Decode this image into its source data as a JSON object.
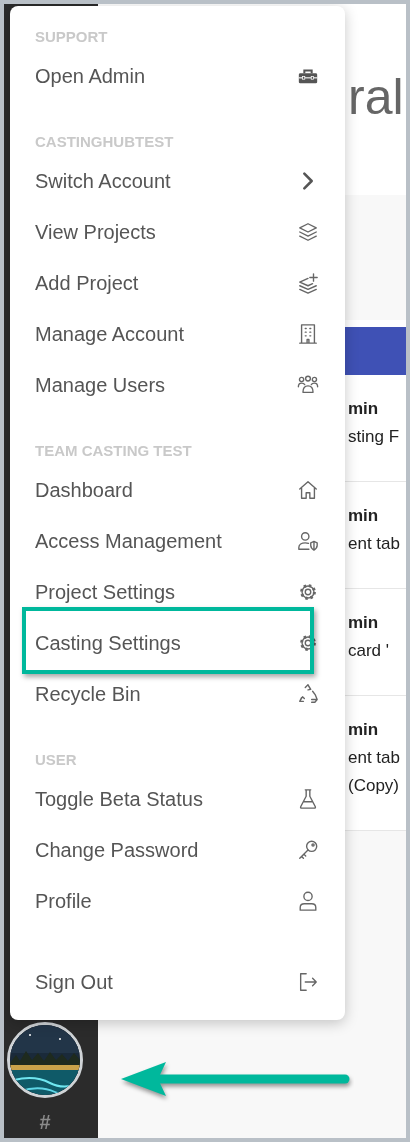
{
  "menu": {
    "sections": [
      {
        "title": "SUPPORT",
        "items": [
          {
            "label": "Open Admin",
            "highlighted": false
          }
        ]
      },
      {
        "title": "CASTINGHUBTEST",
        "items": [
          {
            "label": "Switch Account",
            "highlighted": false
          },
          {
            "label": "View Projects",
            "highlighted": false
          },
          {
            "label": "Add Project",
            "highlighted": false
          },
          {
            "label": "Manage Account",
            "highlighted": false
          },
          {
            "label": "Manage Users",
            "highlighted": false
          }
        ]
      },
      {
        "title": "TEAM CASTING TEST",
        "items": [
          {
            "label": "Dashboard",
            "highlighted": false
          },
          {
            "label": "Access Management",
            "highlighted": false
          },
          {
            "label": "Project Settings",
            "highlighted": false
          },
          {
            "label": "Casting Settings",
            "highlighted": true
          },
          {
            "label": "Recycle Bin",
            "highlighted": false
          }
        ]
      },
      {
        "title": "USER",
        "items": [
          {
            "label": "Toggle Beta Status",
            "highlighted": false
          },
          {
            "label": "Change Password",
            "highlighted": false
          },
          {
            "label": "Profile",
            "highlighted": false
          }
        ]
      },
      {
        "items": [
          {
            "label": "Sign Out",
            "highlighted": false
          }
        ]
      }
    ]
  },
  "background": {
    "heading": "ral",
    "rows": [
      {
        "title": "min",
        "lines": [
          "sting F"
        ]
      },
      {
        "title": "min",
        "lines": [
          "ent tab"
        ]
      },
      {
        "title": "min",
        "lines": [
          "card '"
        ]
      },
      {
        "title": "min",
        "lines": [
          "ent tab",
          "(Copy)"
        ]
      }
    ]
  },
  "sidebar": {
    "label": "#"
  }
}
